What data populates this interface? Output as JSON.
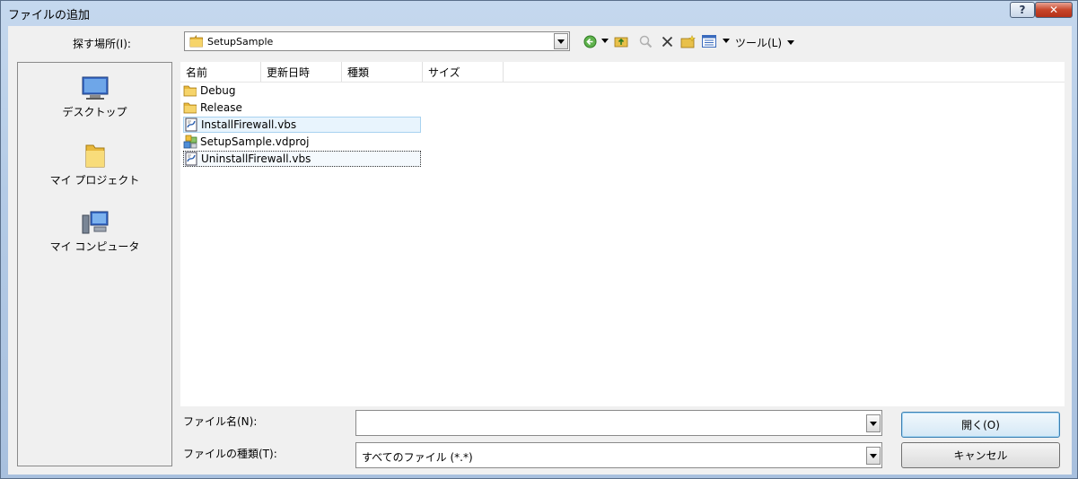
{
  "window": {
    "title": "ファイルの追加",
    "help_label": "?",
    "close_label": "✕"
  },
  "lookin": {
    "label": "探す場所(I):",
    "value": "SetupSample"
  },
  "toolbar": {
    "tools_label": "ツール(L)"
  },
  "places": [
    {
      "label": "デスクトップ",
      "icon": "desktop-icon"
    },
    {
      "label": "マイ プロジェクト",
      "icon": "folder-icon"
    },
    {
      "label": "マイ コンピュータ",
      "icon": "computer-icon"
    }
  ],
  "columns": [
    "名前",
    "更新日時",
    "種類",
    "サイズ"
  ],
  "files": [
    {
      "name": "Debug",
      "icon": "folder-icon"
    },
    {
      "name": "Release",
      "icon": "folder-icon"
    },
    {
      "name": "InstallFirewall.vbs",
      "icon": "script-icon"
    },
    {
      "name": "SetupSample.vdproj",
      "icon": "setup-project-icon"
    },
    {
      "name": "UninstallFirewall.vbs",
      "icon": "script-icon"
    }
  ],
  "filename": {
    "label": "ファイル名(N):",
    "value": ""
  },
  "filetype": {
    "label": "ファイルの種類(T):",
    "value": "すべてのファイル (*.*)"
  },
  "buttons": {
    "open": "開く(O)",
    "cancel": "キャンセル"
  }
}
